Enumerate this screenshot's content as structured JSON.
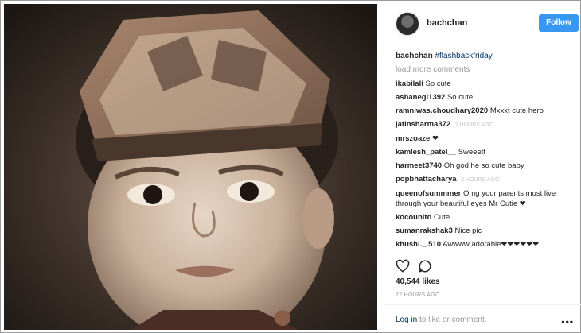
{
  "header": {
    "username": "bachchan",
    "follow_label": "Follow"
  },
  "caption": {
    "username": "bachchan",
    "text": "#flashbackfriday"
  },
  "load_more_label": "load more comments",
  "comments": [
    {
      "user": "ikabilali",
      "text": "So cute",
      "time": ""
    },
    {
      "user": "ashanegi1392",
      "text": "So cute",
      "time": ""
    },
    {
      "user": "ramniwas.choudhary2020",
      "text": "Mxxxt cute hero",
      "time": ""
    },
    {
      "user": "jatinsharma372",
      "text": "",
      "time": "2 HOURS AGO"
    },
    {
      "user": "mrszoaze",
      "text": "❤",
      "time": ""
    },
    {
      "user": "kamlesh_patel__",
      "text": "Sweeett",
      "time": ""
    },
    {
      "user": "harmeet3740",
      "text": "Oh god he so cute baby",
      "time": ""
    },
    {
      "user": "popbhattacharya",
      "text": "",
      "time": "2 HOURS AGO"
    },
    {
      "user": "queenofsummmer",
      "text": "Omg your parents must live through your beautiful eyes Mr Cutie ❤",
      "time": ""
    },
    {
      "user": "kocounltd",
      "text": "Cute",
      "time": ""
    },
    {
      "user": "sumanrakshak3",
      "text": "Nice pic",
      "time": ""
    },
    {
      "user": "khushi._.510",
      "text": "Awwww adorable❤❤❤❤❤❤",
      "time": ""
    }
  ],
  "likes_text": "40,544 likes",
  "post_time": "22 HOURS AGO",
  "login_prompt": {
    "link": "Log in",
    "rest": "to like or comment."
  },
  "more_label": "•••",
  "colors": {
    "follow_blue": "#3897f0",
    "link_blue": "#003569",
    "muted": "#999999"
  }
}
